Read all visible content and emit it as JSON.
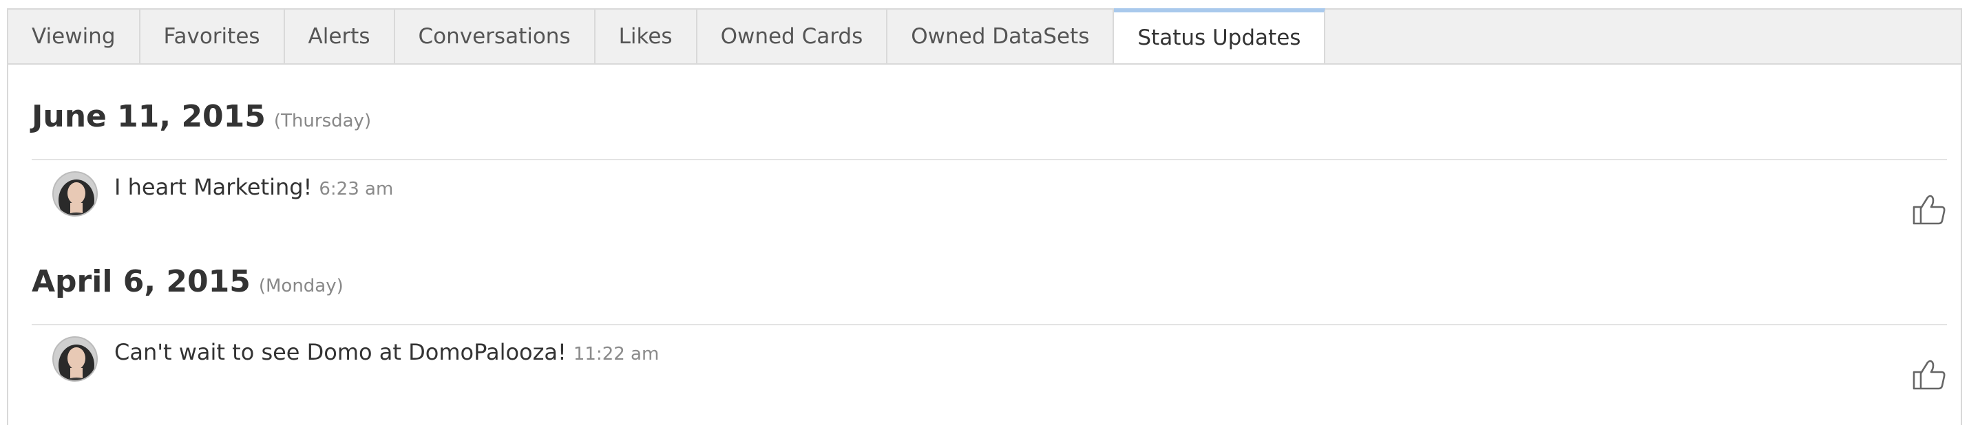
{
  "tabs": [
    {
      "label": "Viewing",
      "active": false
    },
    {
      "label": "Favorites",
      "active": false
    },
    {
      "label": "Alerts",
      "active": false
    },
    {
      "label": "Conversations",
      "active": false
    },
    {
      "label": "Likes",
      "active": false
    },
    {
      "label": "Owned Cards",
      "active": false
    },
    {
      "label": "Owned DataSets",
      "active": false
    },
    {
      "label": "Status Updates",
      "active": true
    }
  ],
  "status_updates": [
    {
      "date": "June 11, 2015",
      "weekday": "(Thursday)",
      "message": "I heart Marketing!",
      "time": "6:23 am"
    },
    {
      "date": "April 6, 2015",
      "weekday": "(Monday)",
      "message": "Can't wait to see Domo at DomoPalooza!",
      "time": "11:22 am"
    }
  ],
  "icons": {
    "like": "thumbs-up-icon",
    "avatar": "avatar"
  },
  "colors": {
    "tab_active_accent": "#a9c9ec",
    "tabbar_bg": "#f0f0f0",
    "border": "#d9d9d9",
    "text": "#333333",
    "muted": "#888888"
  }
}
